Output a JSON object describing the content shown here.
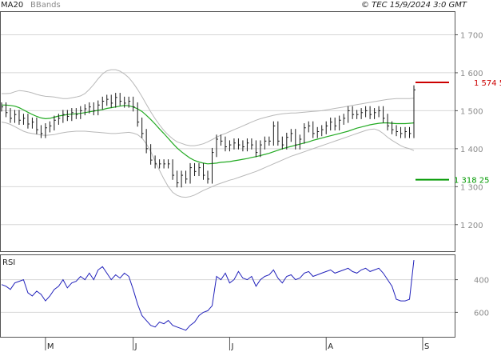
{
  "header": {
    "legend_ma20": "MA20",
    "legend_bbands": "BBands",
    "stamp": "© TEC 15/9/2024 3:0 GMT"
  },
  "colors": {
    "ma20": "#22aa22",
    "bbands": "#b8b8b8",
    "price": "#1a1a1a",
    "rsi": "#2222bb",
    "resistance": "#cc0000",
    "support": "#009900",
    "grid": "#d6d6d6"
  },
  "annotations": {
    "resistance_label": "1 574 5",
    "support_label": "1 318 25"
  },
  "rsi_panel": {
    "label": "RSI",
    "ticks": [
      "600",
      "400"
    ]
  },
  "chart_data": [
    {
      "type": "ohlc",
      "title": "",
      "ylim": [
        1130,
        1760
      ],
      "y_ticks": [
        1200,
        1300,
        1400,
        1500,
        1600,
        1700
      ],
      "y_tick_labels": [
        "1 200",
        "1 300",
        "1 400",
        "1 500",
        "1 600",
        "1 700"
      ],
      "x_month_labels": [
        {
          "label": "M",
          "index": 10
        },
        {
          "label": "J",
          "index": 30
        },
        {
          "label": "J",
          "index": 52
        },
        {
          "label": "A",
          "index": 74
        },
        {
          "label": "S",
          "index": 96
        }
      ],
      "close": [
        1510,
        1495,
        1480,
        1490,
        1475,
        1480,
        1465,
        1470,
        1450,
        1440,
        1455,
        1460,
        1475,
        1480,
        1490,
        1485,
        1495,
        1490,
        1500,
        1505,
        1510,
        1500,
        1515,
        1525,
        1530,
        1520,
        1535,
        1525,
        1520,
        1525,
        1510,
        1470,
        1440,
        1400,
        1370,
        1360,
        1360,
        1360,
        1360,
        1330,
        1310,
        1330,
        1320,
        1350,
        1340,
        1350,
        1330,
        1320,
        1390,
        1425,
        1420,
        1405,
        1410,
        1415,
        1410,
        1405,
        1415,
        1410,
        1390,
        1410,
        1420,
        1420,
        1460,
        1420,
        1410,
        1430,
        1440,
        1410,
        1425,
        1455,
        1460,
        1440,
        1445,
        1450,
        1460,
        1470,
        1460,
        1475,
        1480,
        1500,
        1490,
        1490,
        1495,
        1500,
        1490,
        1495,
        1500,
        1480,
        1460,
        1450,
        1445,
        1440,
        1445,
        1440,
        1555
      ],
      "ma20": [
        1515,
        1515,
        1514,
        1512,
        1508,
        1502,
        1496,
        1490,
        1485,
        1481,
        1479,
        1480,
        1483,
        1486,
        1488,
        1490,
        1491,
        1492,
        1493,
        1495,
        1497,
        1499,
        1501,
        1503,
        1506,
        1508,
        1510,
        1512,
        1514,
        1513,
        1510,
        1505,
        1498,
        1488,
        1477,
        1465,
        1452,
        1440,
        1427,
        1414,
        1402,
        1392,
        1383,
        1375,
        1369,
        1365,
        1362,
        1360,
        1361,
        1362,
        1364,
        1365,
        1366,
        1368,
        1370,
        1372,
        1374,
        1377,
        1379,
        1382,
        1385,
        1388,
        1392,
        1396,
        1400,
        1403,
        1406,
        1409,
        1412,
        1415,
        1418,
        1422,
        1425,
        1428,
        1431,
        1434,
        1437,
        1440,
        1443,
        1446,
        1450,
        1454,
        1457,
        1460,
        1463,
        1465,
        1467,
        1468,
        1468,
        1467,
        1466,
        1466,
        1466,
        1467,
        1468
      ],
      "bb_upper": [
        1545,
        1545,
        1546,
        1550,
        1553,
        1552,
        1550,
        1547,
        1543,
        1540,
        1538,
        1537,
        1536,
        1534,
        1532,
        1532,
        1534,
        1536,
        1539,
        1545,
        1556,
        1569,
        1584,
        1597,
        1605,
        1608,
        1608,
        1604,
        1597,
        1587,
        1573,
        1556,
        1537,
        1517,
        1497,
        1479,
        1463,
        1448,
        1436,
        1426,
        1418,
        1414,
        1410,
        1408,
        1408,
        1410,
        1413,
        1418,
        1424,
        1430,
        1436,
        1440,
        1445,
        1450,
        1455,
        1460,
        1465,
        1470,
        1475,
        1479,
        1482,
        1485,
        1488,
        1490,
        1492,
        1493,
        1494,
        1494,
        1495,
        1496,
        1497,
        1498,
        1499,
        1500,
        1502,
        1504,
        1506,
        1508,
        1510,
        1512,
        1514,
        1516,
        1518,
        1520,
        1522,
        1524,
        1526,
        1528,
        1530,
        1531,
        1532,
        1532,
        1532,
        1532,
        1533
      ],
      "bb_lower": [
        1470,
        1468,
        1464,
        1458,
        1452,
        1446,
        1442,
        1440,
        1438,
        1436,
        1435,
        1436,
        1437,
        1440,
        1442,
        1444,
        1445,
        1446,
        1446,
        1446,
        1445,
        1444,
        1443,
        1442,
        1441,
        1440,
        1440,
        1441,
        1442,
        1443,
        1441,
        1437,
        1428,
        1413,
        1393,
        1367,
        1343,
        1320,
        1300,
        1285,
        1277,
        1273,
        1272,
        1274,
        1278,
        1284,
        1290,
        1295,
        1300,
        1305,
        1309,
        1313,
        1317,
        1320,
        1324,
        1328,
        1332,
        1336,
        1340,
        1345,
        1350,
        1355,
        1360,
        1365,
        1370,
        1375,
        1380,
        1384,
        1388,
        1392,
        1396,
        1400,
        1404,
        1408,
        1412,
        1416,
        1420,
        1424,
        1428,
        1432,
        1436,
        1440,
        1444,
        1448,
        1451,
        1452,
        1448,
        1440,
        1430,
        1422,
        1415,
        1408,
        1403,
        1400,
        1395
      ],
      "support": 1318.25,
      "resistance": 1574.5
    },
    {
      "type": "line",
      "title": "",
      "ylim": [
        250,
        750
      ],
      "y_ticks": [
        400,
        600
      ],
      "series": [
        {
          "values": [
            570,
            560,
            540,
            580,
            590,
            600,
            520,
            500,
            530,
            510,
            470,
            500,
            540,
            560,
            600,
            550,
            580,
            590,
            620,
            600,
            640,
            600,
            660,
            680,
            640,
            600,
            630,
            610,
            640,
            620,
            540,
            450,
            380,
            350,
            320,
            310,
            340,
            330,
            350,
            320,
            310,
            300,
            290,
            320,
            340,
            380,
            400,
            410,
            440,
            620,
            600,
            640,
            580,
            600,
            650,
            610,
            600,
            620,
            560,
            600,
            620,
            630,
            660,
            610,
            580,
            620,
            630,
            600,
            610,
            640,
            650,
            620,
            630,
            640,
            650,
            660,
            640,
            650,
            660,
            670,
            650,
            640,
            660,
            670,
            650,
            660,
            670,
            640,
            600,
            560,
            480,
            470,
            470,
            480,
            720
          ]
        }
      ]
    }
  ]
}
